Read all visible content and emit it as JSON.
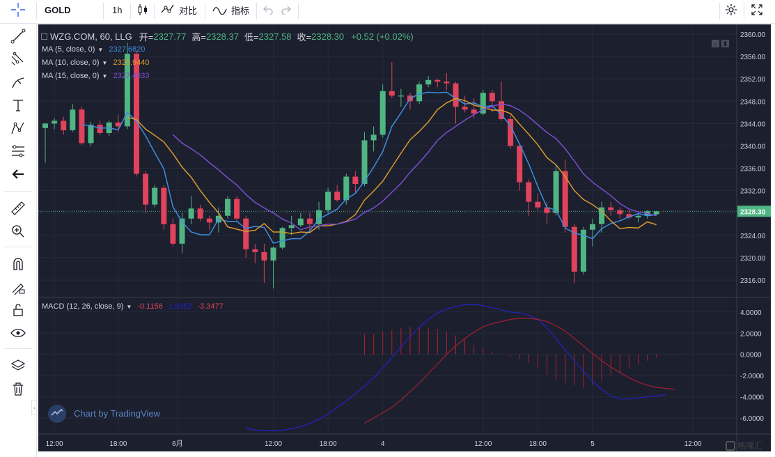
{
  "toolbar": {
    "symbol": "GOLD",
    "interval": "1h",
    "compare_label": "对比",
    "indicators_label": "指标"
  },
  "legend": {
    "title": "WZG.COM, 60, LLG",
    "open_label": "开=",
    "open": "2327.77",
    "high_label": "高=",
    "high": "2328.37",
    "low_label": "低=",
    "low": "2327.58",
    "close_label": "收=",
    "close": "2328.30",
    "change": "+0.52 (+0.02%)",
    "ma5_label": "MA (5, close, 0)",
    "ma5_value": "2327.6820",
    "ma10_label": "MA (10, close, 0)",
    "ma10_value": "2325.9440",
    "ma15_label": "MA (15, close, 0)",
    "ma15_value": "2327.4633",
    "macd_label": "MACD (12, 26, close, 9)",
    "macd_hist": "-0.1156",
    "macd_line": "1.6952",
    "macd_signal": "-3.3477"
  },
  "watermark": "Chart by TradingView",
  "brand": "格隆汇",
  "colors": {
    "up": "#4fb583",
    "down": "#e0435b",
    "ma5": "#3d8ee0",
    "ma10": "#d79b2e",
    "ma15": "#7b4fd0",
    "macd_line": "#2323c8",
    "macd_signal": "#a31f2e",
    "macd_hist": "#b0202e",
    "background": "#1c1f2e"
  },
  "chart_data": [
    {
      "type": "candlestick",
      "x_labels": [
        "12:00",
        "18:00",
        "6月",
        "12:00",
        "18:00",
        "4",
        "12:00",
        "18:00",
        "5",
        "12:00"
      ],
      "price_axis": [
        "2360.00",
        "2356.00",
        "2352.00",
        "2348.00",
        "2344.00",
        "2340.00",
        "2336.00",
        "2332.00",
        "2328.00",
        "2324.00",
        "2320.00",
        "2316.00"
      ],
      "last_price": "2328.30",
      "ylim": [
        2313,
        2361.5
      ],
      "candles": [
        [
          2343.2,
          2344.1,
          2337.0,
          2344.0
        ],
        [
          2344.0,
          2345.0,
          2343.0,
          2344.5
        ],
        [
          2344.5,
          2345.2,
          2342.0,
          2342.8
        ],
        [
          2342.8,
          2347.5,
          2342.5,
          2346.5
        ],
        [
          2346.5,
          2347.0,
          2340.2,
          2340.5
        ],
        [
          2340.5,
          2344.3,
          2340.0,
          2343.8
        ],
        [
          2343.8,
          2344.5,
          2342.0,
          2342.3
        ],
        [
          2342.3,
          2344.5,
          2341.8,
          2344.2
        ],
        [
          2344.2,
          2345.5,
          2342.5,
          2343.5
        ],
        [
          2343.5,
          2358.5,
          2343.0,
          2356.5
        ],
        [
          2356.5,
          2357.0,
          2334.5,
          2335.0
        ],
        [
          2335.0,
          2335.5,
          2328.0,
          2329.5
        ],
        [
          2329.5,
          2333.0,
          2329.0,
          2332.5
        ],
        [
          2332.5,
          2333.0,
          2325.0,
          2326.0
        ],
        [
          2326.0,
          2327.0,
          2322.0,
          2322.5
        ],
        [
          2322.5,
          2328.0,
          2320.8,
          2327.0
        ],
        [
          2327.0,
          2331.0,
          2326.0,
          2328.8
        ],
        [
          2328.8,
          2329.5,
          2326.5,
          2327.0
        ],
        [
          2327.0,
          2327.5,
          2325.0,
          2326.3
        ],
        [
          2326.3,
          2329.0,
          2324.5,
          2327.5
        ],
        [
          2327.5,
          2331.0,
          2327.0,
          2330.5
        ],
        [
          2330.5,
          2331.0,
          2326.5,
          2327.0
        ],
        [
          2327.0,
          2327.5,
          2320.0,
          2321.5
        ],
        [
          2321.5,
          2322.5,
          2319.0,
          2321.0
        ],
        [
          2321.0,
          2322.5,
          2315.5,
          2319.5
        ],
        [
          2319.5,
          2322.0,
          2314.5,
          2321.8
        ],
        [
          2321.8,
          2325.5,
          2321.5,
          2325.3
        ],
        [
          2325.3,
          2327.5,
          2324.0,
          2325.8
        ],
        [
          2325.8,
          2328.0,
          2325.5,
          2327.0
        ],
        [
          2327.0,
          2328.0,
          2324.5,
          2326.0
        ],
        [
          2326.0,
          2330.0,
          2325.0,
          2328.5
        ],
        [
          2328.5,
          2332.5,
          2328.0,
          2331.8
        ],
        [
          2331.8,
          2333.0,
          2330.0,
          2330.3
        ],
        [
          2330.3,
          2335.0,
          2329.5,
          2334.5
        ],
        [
          2334.5,
          2335.5,
          2331.5,
          2333.2
        ],
        [
          2333.2,
          2342.5,
          2332.8,
          2341.0
        ],
        [
          2341.0,
          2343.5,
          2339.0,
          2342.0
        ],
        [
          2342.0,
          2351.0,
          2341.5,
          2349.8
        ],
        [
          2349.8,
          2355.0,
          2348.5,
          2349.0
        ],
        [
          2349.0,
          2350.2,
          2347.0,
          2349.0
        ],
        [
          2349.0,
          2349.5,
          2346.5,
          2348.0
        ],
        [
          2348.0,
          2351.5,
          2347.5,
          2351.0
        ],
        [
          2351.0,
          2352.5,
          2350.5,
          2351.8
        ],
        [
          2351.8,
          2352.0,
          2350.5,
          2351.5
        ],
        [
          2351.5,
          2353.0,
          2350.0,
          2351.2
        ],
        [
          2351.2,
          2351.5,
          2344.0,
          2347.0
        ],
        [
          2347.0,
          2349.0,
          2346.0,
          2346.5
        ],
        [
          2346.5,
          2348.5,
          2345.0,
          2345.8
        ],
        [
          2345.8,
          2350.0,
          2345.5,
          2349.5
        ],
        [
          2349.5,
          2350.0,
          2346.0,
          2348.0
        ],
        [
          2348.0,
          2351.5,
          2344.5,
          2344.8
        ],
        [
          2344.8,
          2345.5,
          2339.5,
          2340.0
        ],
        [
          2340.0,
          2340.5,
          2332.0,
          2333.5
        ],
        [
          2333.5,
          2334.0,
          2327.5,
          2330.0
        ],
        [
          2330.0,
          2331.5,
          2328.5,
          2329.0
        ],
        [
          2329.0,
          2330.0,
          2326.0,
          2328.0
        ],
        [
          2328.0,
          2336.5,
          2327.5,
          2335.5
        ],
        [
          2335.5,
          2337.5,
          2324.5,
          2325.5
        ],
        [
          2325.5,
          2326.0,
          2315.5,
          2317.5
        ],
        [
          2317.5,
          2325.5,
          2317.0,
          2325.0
        ],
        [
          2325.0,
          2327.0,
          2322.0,
          2326.0
        ],
        [
          2326.0,
          2330.0,
          2324.5,
          2329.0
        ],
        [
          2329.0,
          2330.0,
          2327.5,
          2328.5
        ],
        [
          2328.5,
          2329.0,
          2327.0,
          2327.8
        ],
        [
          2327.8,
          2328.5,
          2326.8,
          2327.2
        ],
        [
          2327.2,
          2328.0,
          2326.3,
          2327.5
        ],
        [
          2327.5,
          2328.5,
          2327.0,
          2328.3
        ],
        [
          2327.77,
          2328.37,
          2327.58,
          2328.3
        ]
      ],
      "series": [
        {
          "name": "MA (5, close, 0)",
          "values": [
            null,
            null,
            null,
            null,
            2343.8,
            2343.6,
            2343.2,
            2343.2,
            2342.9,
            2346.0,
            2344.4,
            2341.8,
            2338.8,
            2335.9,
            2329.1,
            2326.4,
            2324.6,
            2324.1,
            2324.1,
            2326.9,
            2326.5,
            2326.5,
            2325.2,
            2325.6,
            2325.4,
            2322.6,
            2323.0,
            2323.4,
            2323.4,
            2324.8,
            2326.9,
            2327.8,
            2328.7,
            2330.5,
            2331.5,
            2333.7,
            2336.2,
            2339.0,
            2343.5,
            2345.9,
            2348.5,
            2349.3,
            2349.6,
            2349.5,
            2349.6,
            2348.5,
            2347.5,
            2347.7,
            2347.0,
            2347.2,
            2345.6,
            2343.6,
            2340.3,
            2336.8,
            2332.7,
            2329.0,
            2328.5,
            2325.3,
            2324.4,
            2324.0,
            2323.4,
            2325.2,
            2326.1,
            2326.6,
            2327.3,
            2327.9,
            2327.5,
            2327.7
          ]
        },
        {
          "name": "MA (10, close, 0)",
          "values": [
            null,
            null,
            null,
            null,
            null,
            null,
            null,
            null,
            null,
            2345.1,
            2344.7,
            2343.0,
            2341.9,
            2340.7,
            2338.6,
            2336.2,
            2334.4,
            2332.0,
            2329.9,
            2328.0,
            2325.5,
            2325.1,
            2324.7,
            2324.9,
            2326.1,
            2324.6,
            2324.6,
            2324.3,
            2324.6,
            2324.5,
            2325.7,
            2325.7,
            2326.0,
            2326.5,
            2327.7,
            2330.3,
            2331.9,
            2333.7,
            2336.2,
            2338.7,
            2341.1,
            2342.6,
            2344.3,
            2346.5,
            2347.7,
            2348.5,
            2348.1,
            2347.3,
            2346.9,
            2346.4,
            2346.4,
            2345.8,
            2343.9,
            2342.1,
            2340.2,
            2337.9,
            2336.6,
            2334.5,
            2332.0,
            2330.4,
            2329.5,
            2328.3,
            2326.6,
            2325.2,
            2325.4,
            2325.3,
            2326.4,
            2325.9
          ]
        },
        {
          "name": "MA (15, close, 0)",
          "values": [
            null,
            null,
            null,
            null,
            null,
            null,
            null,
            null,
            null,
            null,
            null,
            null,
            null,
            null,
            2342.0,
            2340.5,
            2339.5,
            2338.4,
            2337.0,
            2335.7,
            2334.3,
            2333.0,
            2331.3,
            2329.9,
            2328.9,
            2328.0,
            2326.9,
            2326.2,
            2325.0,
            2325.5,
            2325.7,
            2326.0,
            2326.0,
            2326.4,
            2326.9,
            2328.1,
            2328.9,
            2330.1,
            2331.7,
            2333.3,
            2335.3,
            2337.0,
            2338.9,
            2341.0,
            2342.4,
            2343.5,
            2344.6,
            2345.6,
            2346.5,
            2347.1,
            2347.5,
            2347.2,
            2346.4,
            2345.2,
            2343.8,
            2342.4,
            2341.3,
            2339.5,
            2337.3,
            2335.0,
            2333.5,
            2332.3,
            2331.1,
            2329.7,
            2328.7,
            2328.2,
            2327.9,
            2327.5
          ]
        }
      ]
    },
    {
      "type": "line",
      "title": "MACD (12, 26, close, 9)",
      "y_axis": [
        "4.0000",
        "2.0000",
        "0.0000",
        "-2.0000",
        "-4.0000",
        "-6.0000"
      ],
      "ylim": [
        -7.5,
        5.3
      ],
      "series": [
        {
          "name": "MACD",
          "start_index": 22,
          "values": [
            -7.0,
            -7.1,
            -7.2,
            -7.2,
            -7.15,
            -7.0,
            -6.8,
            -6.5,
            -6.1,
            -5.6,
            -5.0,
            -4.4,
            -3.7,
            -3.0,
            -2.2,
            -1.3,
            -0.3,
            0.7,
            1.7,
            2.6,
            3.3,
            3.9,
            4.3,
            4.5,
            4.7,
            4.7,
            4.6,
            4.4,
            4.2,
            4.0,
            3.9,
            3.7,
            3.3,
            2.5,
            1.5,
            0.4,
            -0.6,
            -1.6,
            -2.5,
            -3.3,
            -3.9,
            -4.2,
            -4.2,
            -4.1,
            -4.0,
            -3.9,
            -3.8
          ]
        },
        {
          "name": "Signal",
          "start_index": 35,
          "values": [
            -6.5,
            -6.0,
            -5.5,
            -5.0,
            -4.3,
            -3.5,
            -2.7,
            -1.8,
            -0.9,
            0.0,
            0.8,
            1.5,
            2.1,
            2.6,
            2.9,
            3.1,
            3.3,
            3.4,
            3.4,
            3.3,
            3.1,
            2.7,
            2.2,
            1.5,
            0.8,
            0.1,
            -0.6,
            -1.2,
            -1.7,
            -2.2,
            -2.6,
            -2.9,
            -3.1,
            -3.2,
            -3.3
          ]
        },
        {
          "name": "Histogram",
          "start_index": 35,
          "values": [
            1.9,
            1.9,
            2.2,
            2.3,
            2.5,
            2.6,
            2.5,
            2.5,
            2.4,
            2.2,
            1.8,
            1.4,
            0.9,
            0.6,
            0.3,
            0.0,
            -0.2,
            -0.4,
            -0.8,
            -1.3,
            -1.9,
            -2.4,
            -2.7,
            -2.9,
            -3.1,
            -2.9,
            -2.5,
            -2.1,
            -1.7,
            -1.2,
            -0.9,
            -0.6,
            -0.3,
            -0.1,
            -0.1
          ]
        }
      ]
    }
  ]
}
